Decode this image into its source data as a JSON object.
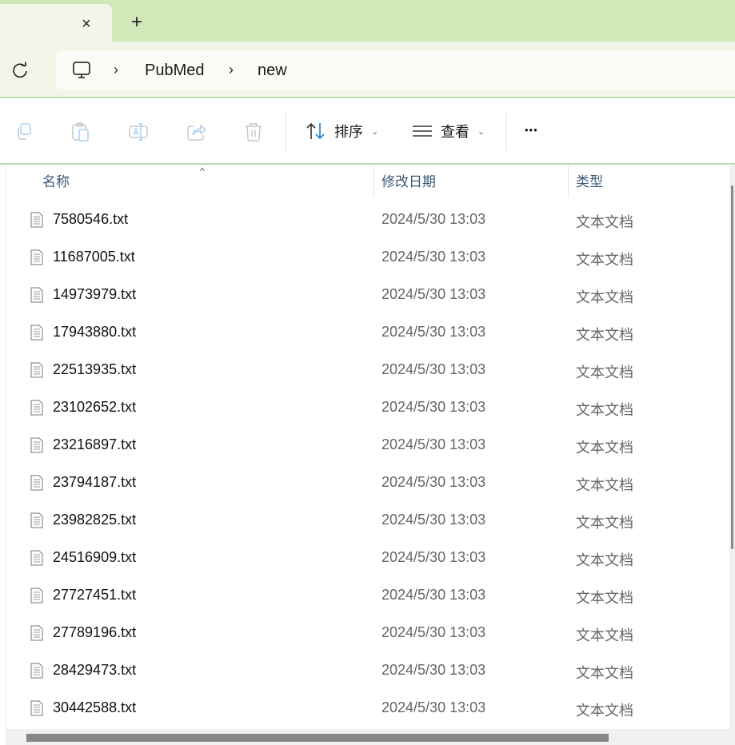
{
  "titlebar": {
    "close_tab_glyph": "×",
    "new_tab_glyph": "+"
  },
  "breadcrumb": [
    "PubMed",
    "new"
  ],
  "toolbar": {
    "sort_label": "排序",
    "view_label": "查看",
    "more_glyph": "•••"
  },
  "columns": {
    "name": "名称",
    "date": "修改日期",
    "type": "类型"
  },
  "files": [
    {
      "name": "7580546.txt",
      "date": "2024/5/30 13:03",
      "type": "文本文档"
    },
    {
      "name": "11687005.txt",
      "date": "2024/5/30 13:03",
      "type": "文本文档"
    },
    {
      "name": "14973979.txt",
      "date": "2024/5/30 13:03",
      "type": "文本文档"
    },
    {
      "name": "17943880.txt",
      "date": "2024/5/30 13:03",
      "type": "文本文档"
    },
    {
      "name": "22513935.txt",
      "date": "2024/5/30 13:03",
      "type": "文本文档"
    },
    {
      "name": "23102652.txt",
      "date": "2024/5/30 13:03",
      "type": "文本文档"
    },
    {
      "name": "23216897.txt",
      "date": "2024/5/30 13:03",
      "type": "文本文档"
    },
    {
      "name": "23794187.txt",
      "date": "2024/5/30 13:03",
      "type": "文本文档"
    },
    {
      "name": "23982825.txt",
      "date": "2024/5/30 13:03",
      "type": "文本文档"
    },
    {
      "name": "24516909.txt",
      "date": "2024/5/30 13:03",
      "type": "文本文档"
    },
    {
      "name": "27727451.txt",
      "date": "2024/5/30 13:03",
      "type": "文本文档"
    },
    {
      "name": "27789196.txt",
      "date": "2024/5/30 13:03",
      "type": "文本文档"
    },
    {
      "name": "28429473.txt",
      "date": "2024/5/30 13:03",
      "type": "文本文档"
    },
    {
      "name": "30442588.txt",
      "date": "2024/5/30 13:03",
      "type": "文本文档"
    }
  ],
  "colors": {
    "accent": "#1e7bd1",
    "chrome": "#d2e8b8",
    "nav": "#f1f6e9"
  }
}
